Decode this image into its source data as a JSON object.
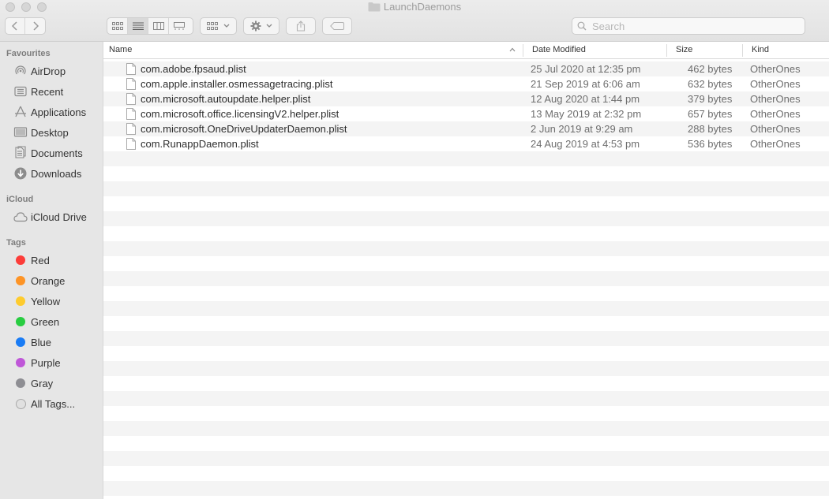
{
  "window": {
    "title": "LaunchDaemons"
  },
  "toolbar": {
    "search_placeholder": "Search",
    "view_modes": [
      "icon-view",
      "list-view",
      "column-view",
      "gallery-view"
    ],
    "active_view": "list-view"
  },
  "sidebar": {
    "favourites_header": "Favourites",
    "favourites": [
      {
        "label": "AirDrop",
        "icon": "airdrop-icon"
      },
      {
        "label": "Recent",
        "icon": "recent-icon"
      },
      {
        "label": "Applications",
        "icon": "applications-icon"
      },
      {
        "label": "Desktop",
        "icon": "desktop-icon"
      },
      {
        "label": "Documents",
        "icon": "documents-icon"
      },
      {
        "label": "Downloads",
        "icon": "downloads-icon"
      }
    ],
    "icloud_header": "iCloud",
    "icloud": [
      {
        "label": "iCloud Drive",
        "icon": "icloud-icon"
      }
    ],
    "tags_header": "Tags",
    "tags": [
      {
        "label": "Red",
        "color": "#fc3d39"
      },
      {
        "label": "Orange",
        "color": "#fd9426"
      },
      {
        "label": "Yellow",
        "color": "#fecb2e"
      },
      {
        "label": "Green",
        "color": "#28cd41"
      },
      {
        "label": "Blue",
        "color": "#1a7cf5"
      },
      {
        "label": "Purple",
        "color": "#bf57d8"
      },
      {
        "label": "Gray",
        "color": "#8e8e93"
      },
      {
        "label": "All Tags...",
        "color": "#e0e0e0"
      }
    ]
  },
  "list": {
    "columns": {
      "name": "Name",
      "date": "Date Modified",
      "size": "Size",
      "kind": "Kind"
    },
    "sort_column": "name",
    "files": [
      {
        "name": "com.adobe.fpsaud.plist",
        "date": "25 Jul 2020 at 12:35 pm",
        "size": "462 bytes",
        "kind": "OtherOnes"
      },
      {
        "name": "com.apple.installer.osmessagetracing.plist",
        "date": "21 Sep 2019 at 6:06 am",
        "size": "632 bytes",
        "kind": "OtherOnes"
      },
      {
        "name": "com.microsoft.autoupdate.helper.plist",
        "date": "12 Aug 2020 at 1:44 pm",
        "size": "379 bytes",
        "kind": "OtherOnes"
      },
      {
        "name": "com.microsoft.office.licensingV2.helper.plist",
        "date": "13 May 2019 at 2:32 pm",
        "size": "657 bytes",
        "kind": "OtherOnes"
      },
      {
        "name": "com.microsoft.OneDriveUpdaterDaemon.plist",
        "date": "2 Jun 2019 at 9:29 am",
        "size": "288 bytes",
        "kind": "OtherOnes"
      },
      {
        "name": "com.RunappDaemon.plist",
        "date": "24 Aug 2019 at 4:53 pm",
        "size": "536 bytes",
        "kind": "OtherOnes"
      }
    ]
  }
}
